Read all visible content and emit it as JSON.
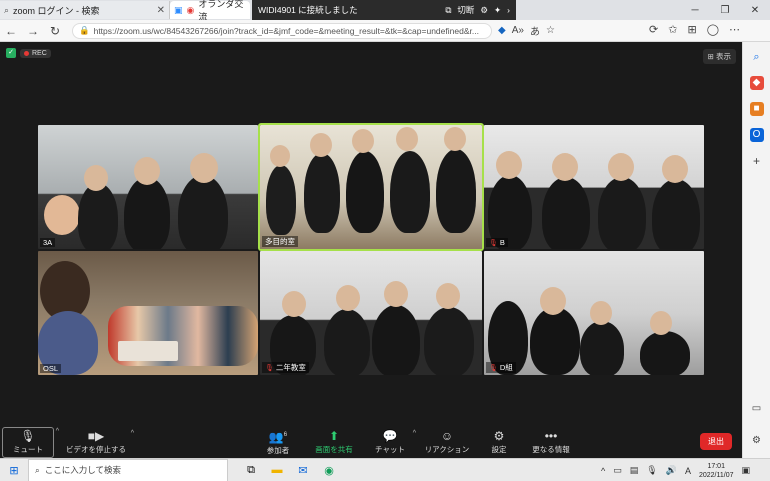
{
  "browser": {
    "tabs": [
      {
        "title": "zoom ログイン - 検索",
        "active": false
      },
      {
        "title": "オランダ交流",
        "active": true
      }
    ],
    "cast": {
      "title": "WIDI4901 に接続しました",
      "disconnect": "切断"
    },
    "url": "https://zoom.us/wc/84543267266/join?track_id=&jmf_code=&meeting_result=&tk=&cap=undefined&r..."
  },
  "meeting": {
    "rec_label": "REC",
    "view_label": "表示",
    "tiles": [
      {
        "label": "3A",
        "muted": false
      },
      {
        "label": "多目的室",
        "muted": false,
        "active": true
      },
      {
        "label": "B",
        "muted": true
      },
      {
        "label": "OSL",
        "muted": false
      },
      {
        "label": "二年教室",
        "muted": true
      },
      {
        "label": "D組",
        "muted": true
      }
    ]
  },
  "controls": {
    "mute": "ミュート",
    "video": "ビデオを停止する",
    "participants": "参加者",
    "participants_count": "6",
    "share": "画面を共有",
    "chat": "チャット",
    "reaction": "リアクション",
    "settings": "設定",
    "more": "更なる情報",
    "exit": "退出"
  },
  "taskbar": {
    "search_placeholder": "ここに入力して検索",
    "time": "17:01",
    "date": "2022/11/07",
    "ime": "A"
  },
  "colors": {
    "active_speaker": "#a6e04a",
    "share_green": "#2ecc71",
    "exit_red": "#e02828",
    "rec_red": "#e53935"
  }
}
